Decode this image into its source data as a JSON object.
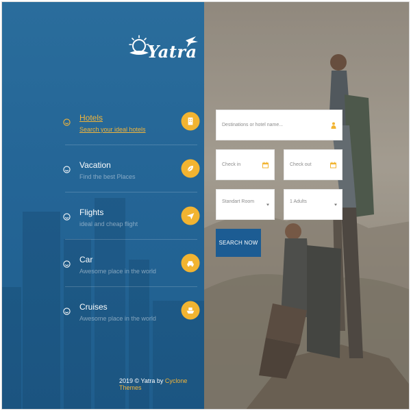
{
  "brand": {
    "logo_text": "Yatra"
  },
  "menu": {
    "items": [
      {
        "title": "Hotels",
        "subtitle": "Search your ideal hotels",
        "icon": "hotel-icon",
        "active": true
      },
      {
        "title": "Vacation",
        "subtitle": "Find the best Places",
        "icon": "leaf-icon",
        "active": false
      },
      {
        "title": "Flights",
        "subtitle": "ideal and cheap flight",
        "icon": "plane-icon",
        "active": false
      },
      {
        "title": "Car",
        "subtitle": "Awesome place in the world",
        "icon": "car-icon",
        "active": false
      },
      {
        "title": "Cruises",
        "subtitle": "Awesome place in the world",
        "icon": "cruise-icon",
        "active": false
      }
    ]
  },
  "footer": {
    "prefix": "2019 © Yatra by ",
    "brand": "Cyclone Themes"
  },
  "search": {
    "destination_placeholder": "Destinations or hotel name...",
    "checkin_placeholder": "Check in",
    "checkout_placeholder": "Check out",
    "room_value": "Standart Room",
    "adults_value": "1 Adults",
    "button_label": "SEARCH NOW"
  },
  "colors": {
    "panel_blue": "#246596",
    "accent_yellow": "#f2b431",
    "button_blue": "#1c5c93"
  }
}
